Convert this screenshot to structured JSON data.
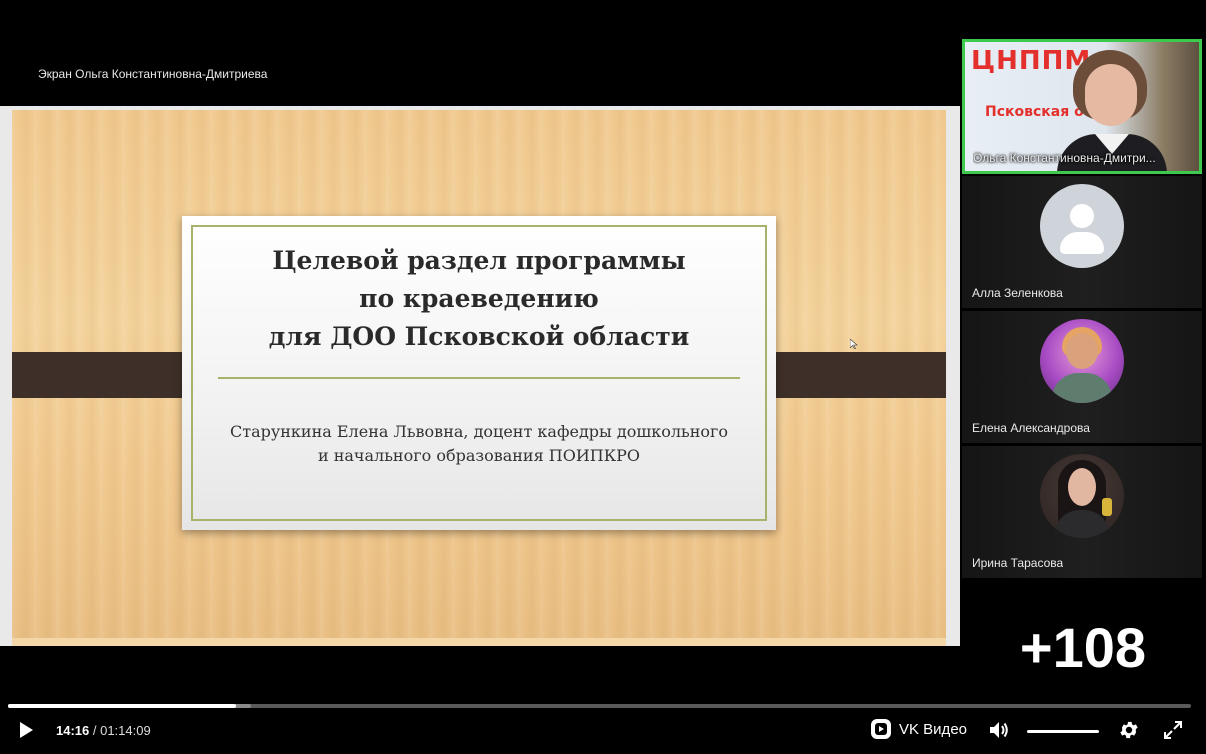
{
  "screen_caption": "Экран Ольга Константиновна-Дмитриева",
  "slide": {
    "title_lines": [
      "Целевой раздел программы",
      "по краеведению",
      "для ДОО Псковской области"
    ],
    "subtitle_lines": [
      "Старункина Елена Львовна, доцент кафедры дошкольного",
      "и начального образования ПОИПКРО"
    ]
  },
  "participants": [
    {
      "name": "Ольга Константиновна-Дмитри...",
      "active": true,
      "camera_logo": "ЦНППМ",
      "camera_logo_sub": "Псковская об"
    },
    {
      "name": "Алла Зеленкова",
      "avatar": "default"
    },
    {
      "name": "Елена Александрова",
      "avatar": "photo"
    },
    {
      "name": "Ирина Тарасова",
      "avatar": "photo"
    }
  ],
  "more_participants": "+108",
  "player": {
    "current_time": "14:16",
    "separator": " / ",
    "total_time": "01:14:09",
    "progress_fraction": 0.193,
    "buffered_fraction": 0.205,
    "volume_fraction": 1.0,
    "brand_label": "VK Видео",
    "icons": [
      "play-icon",
      "vk-video-logo-icon",
      "volume-icon",
      "gear-icon",
      "fullscreen-icon"
    ]
  },
  "colors": {
    "active_speaker_border": "#3cc94d",
    "slide_band": "#3e2f28",
    "slide_rule": "#a9b26a"
  }
}
